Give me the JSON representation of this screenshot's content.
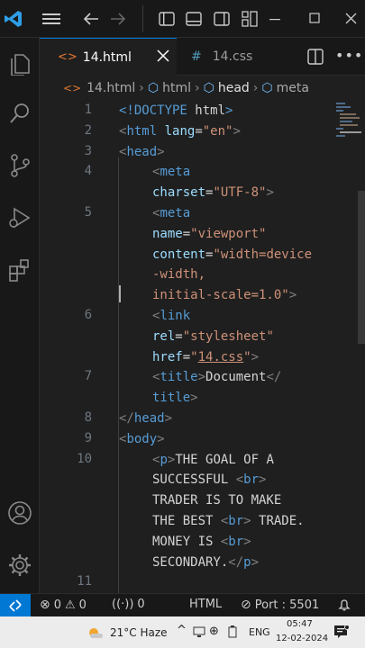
{
  "tabs": [
    {
      "label": "14.html",
      "icon": "html-file-icon",
      "active": true
    },
    {
      "label": "14.css",
      "icon": "css-file-icon",
      "active": false
    }
  ],
  "breadcrumbs": [
    "14.html",
    "html",
    "head",
    "meta"
  ],
  "lines": [
    {
      "num": "1",
      "parts": [
        [
          "tag",
          "<!DOCTYPE "
        ],
        [
          "txt",
          "html"
        ],
        [
          "tag",
          ">"
        ]
      ],
      "indent": 0
    },
    {
      "num": "2",
      "parts": [
        [
          "punc",
          "<"
        ],
        [
          "tag",
          "html "
        ],
        [
          "attr",
          "lang"
        ],
        [
          "txt",
          "="
        ],
        [
          "str",
          "\"en\""
        ],
        [
          "punc",
          ">"
        ]
      ],
      "indent": 0
    },
    {
      "num": "3",
      "parts": [
        [
          "punc",
          "<"
        ],
        [
          "tag",
          "head"
        ],
        [
          "punc",
          ">"
        ]
      ],
      "indent": 0
    },
    {
      "num": "4",
      "parts": [
        [
          "punc",
          "<"
        ],
        [
          "tag",
          "meta"
        ]
      ],
      "indent": 1
    },
    {
      "num": "",
      "parts": [
        [
          "attr",
          "charset"
        ],
        [
          "txt",
          "="
        ],
        [
          "str",
          "\"UTF-8\""
        ],
        [
          "punc",
          ">"
        ]
      ],
      "indent": 1
    },
    {
      "num": "5",
      "parts": [
        [
          "punc",
          "<"
        ],
        [
          "tag",
          "meta"
        ]
      ],
      "indent": 1
    },
    {
      "num": "",
      "parts": [
        [
          "attr",
          "name"
        ],
        [
          "txt",
          "="
        ],
        [
          "str",
          "\"viewport\""
        ]
      ],
      "indent": 1
    },
    {
      "num": "",
      "parts": [
        [
          "attr",
          "content"
        ],
        [
          "txt",
          "="
        ],
        [
          "str",
          "\"width=device"
        ]
      ],
      "indent": 1
    },
    {
      "num": "",
      "parts": [
        [
          "str",
          "-width,"
        ]
      ],
      "indent": 1
    },
    {
      "num": "",
      "parts": [
        [
          "str",
          "initial-scale=1.0\""
        ],
        [
          "punc",
          ">"
        ]
      ],
      "indent": 1
    },
    {
      "num": "6",
      "parts": [
        [
          "punc",
          "<"
        ],
        [
          "tag",
          "link"
        ]
      ],
      "indent": 1
    },
    {
      "num": "",
      "parts": [
        [
          "attr",
          "rel"
        ],
        [
          "txt",
          "="
        ],
        [
          "str",
          "\"stylesheet\""
        ]
      ],
      "indent": 1
    },
    {
      "num": "",
      "parts": [
        [
          "attr",
          "href"
        ],
        [
          "txt",
          "="
        ],
        [
          "str",
          "\""
        ],
        [
          "str",
          "14.css"
        ],
        [
          "str",
          "\""
        ],
        [
          "punc",
          ">"
        ]
      ],
      "indent": 1
    },
    {
      "num": "7",
      "parts": [
        [
          "punc",
          "<"
        ],
        [
          "tag",
          "title"
        ],
        [
          "punc",
          ">"
        ],
        [
          "txt",
          "Document"
        ],
        [
          "punc",
          "</"
        ]
      ],
      "indent": 1
    },
    {
      "num": "",
      "parts": [
        [
          "tag",
          "title"
        ],
        [
          "punc",
          ">"
        ]
      ],
      "indent": 1
    },
    {
      "num": "8",
      "parts": [
        [
          "punc",
          "</"
        ],
        [
          "tag",
          "head"
        ],
        [
          "punc",
          ">"
        ]
      ],
      "indent": 0
    },
    {
      "num": "9",
      "parts": [
        [
          "punc",
          "<"
        ],
        [
          "tag",
          "body"
        ],
        [
          "punc",
          ">"
        ]
      ],
      "indent": 0
    },
    {
      "num": "10",
      "parts": [
        [
          "punc",
          "<"
        ],
        [
          "tag",
          "p"
        ],
        [
          "punc",
          ">"
        ],
        [
          "txt",
          "THE GOAL OF A"
        ]
      ],
      "indent": 1
    },
    {
      "num": "",
      "parts": [
        [
          "txt",
          "SUCCESSFUL "
        ],
        [
          "punc",
          "<"
        ],
        [
          "tag",
          "br"
        ],
        [
          "punc",
          ">"
        ]
      ],
      "indent": 1
    },
    {
      "num": "",
      "parts": [
        [
          "txt",
          "TRADER IS TO MAKE"
        ]
      ],
      "indent": 1
    },
    {
      "num": "",
      "parts": [
        [
          "txt",
          "THE BEST "
        ],
        [
          "punc",
          "<"
        ],
        [
          "tag",
          "br"
        ],
        [
          "punc",
          ">"
        ],
        [
          "txt",
          " TRADE."
        ]
      ],
      "indent": 1
    },
    {
      "num": "",
      "parts": [
        [
          "txt",
          "MONEY IS "
        ],
        [
          "punc",
          "<"
        ],
        [
          "tag",
          "br"
        ],
        [
          "punc",
          ">"
        ]
      ],
      "indent": 1
    },
    {
      "num": "",
      "parts": [
        [
          "txt",
          "SECONDARY."
        ],
        [
          "punc",
          "</"
        ],
        [
          "tag",
          "p"
        ],
        [
          "punc",
          ">"
        ]
      ],
      "indent": 1
    },
    {
      "num": "11",
      "parts": [],
      "indent": 0
    }
  ],
  "status": {
    "errors": "0",
    "warnings": "0",
    "ports": "0",
    "language": "HTML",
    "port": "Port : 5501"
  },
  "taskbar": {
    "weather": "21°C Haze",
    "lang": "ENG",
    "time": "05:47",
    "date": "12-02-2024"
  },
  "colors": {
    "accent": "#0078d4"
  }
}
